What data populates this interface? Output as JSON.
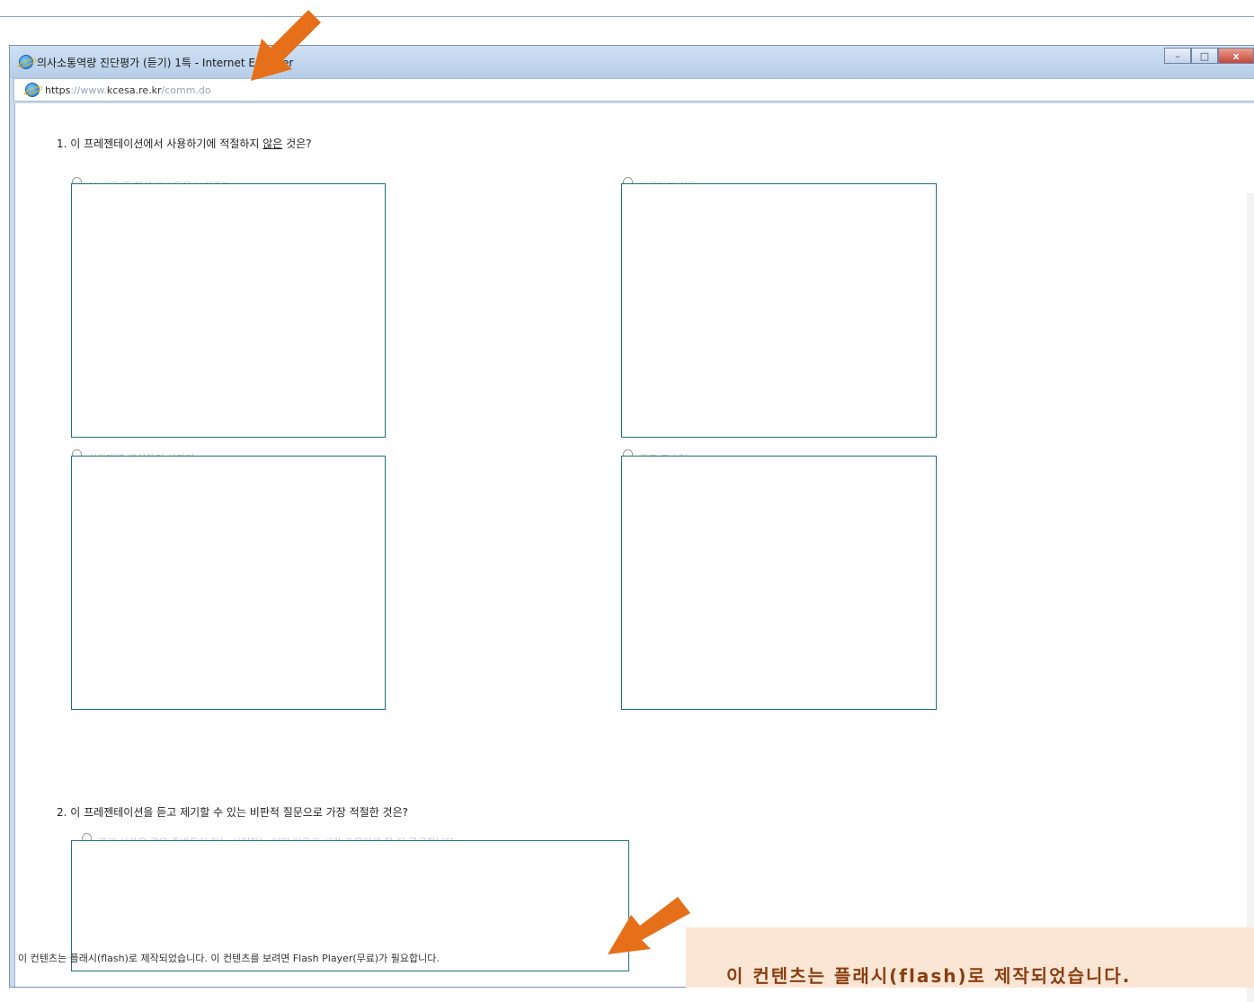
{
  "window": {
    "title": "의사소통역량 진단평가 (듣기) 1특 - Internet Explorer",
    "url_scheme": "https",
    "url_prefix": "://www.",
    "url_domain": "kcesa.re.kr",
    "url_path": "/comm.do",
    "buttons": [
      "–",
      "□",
      "x"
    ]
  },
  "questions": [
    {
      "number": "1.",
      "text_before": "이 프레젠테이션에서 사용하기에 적절하지 ",
      "text_underlined": "않은",
      "text_after": " 것은?",
      "options": [
        "이 내용 중 핵심 요소들을 보여준다",
        "이해하기 쉬운",
        "시간대별 해설하기 시키기",
        "광고 포스터"
      ]
    },
    {
      "number": "2.",
      "text": "이 프레젠테이션을 듣고 제기할 수 있는 비판적 질문으로 가장 적절한 것은?",
      "options": [
        "광고 시간은 같은 주변들이 하는 시청자는 어떤 이유로 시간 조율하게 될 지 궁금합니다"
      ]
    }
  ],
  "flash_notice": "이 컨텐츠는 플래시(flash)로 제작되었습니다. 이 컨텐츠를 보려면 Flash Player(무료)가 필요합니다.",
  "callout_text": "이 컨텐츠는 플래시(flash)로 제작되었습니다.",
  "colors": {
    "arrow": "#e67019",
    "callout_bg": "#fbe6d6",
    "callout_text": "#8a3e12",
    "box_border": "#1d6f78"
  },
  "icons": {
    "browser": "ie-icon",
    "arrow": "arrow-annotation-icon"
  }
}
